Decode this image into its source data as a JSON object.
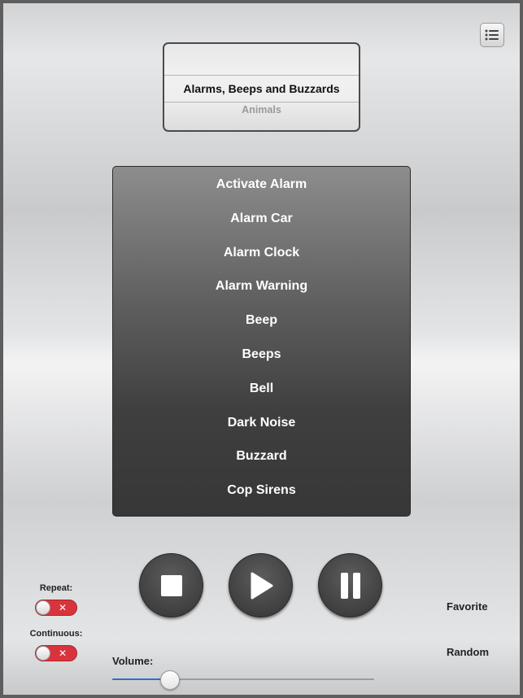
{
  "picker": {
    "selected": "Alarms, Beeps and Buzzards",
    "next": "Animals"
  },
  "sounds": [
    "Activate Alarm",
    "Alarm Car",
    "Alarm Clock",
    "Alarm Warning",
    "Beep",
    "Beeps",
    "Bell",
    "Dark Noise",
    "Buzzard",
    "Cop Sirens"
  ],
  "options": {
    "repeat_label": "Repeat:",
    "repeat_state": "off",
    "continuous_label": "Continuous:",
    "continuous_state": "off",
    "toggle_off_symbol": "✕"
  },
  "controls": {
    "stop_icon": "stop-icon",
    "play_icon": "play-icon",
    "pause_icon": "pause-icon"
  },
  "actions": {
    "favorite_label": "Favorite",
    "random_label": "Random"
  },
  "volume": {
    "label": "Volume:",
    "level": 0.22
  },
  "colors": {
    "toggle_off": "#d9343d",
    "slider_fill": "#2f6fc8"
  }
}
